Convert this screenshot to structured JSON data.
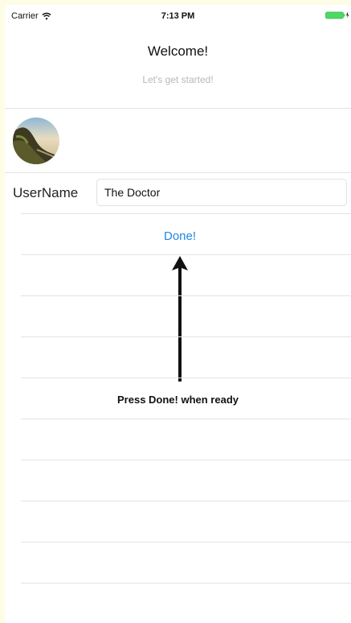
{
  "status_bar": {
    "carrier": "Carrier",
    "time": "7:13 PM",
    "icons": [
      "wifi-icon",
      "battery-icon"
    ],
    "battery_color": "#4cd964"
  },
  "header": {
    "title": "Welcome!",
    "subtitle": "Let's get started!"
  },
  "profile": {
    "avatar_icon": "avatar-photo"
  },
  "form": {
    "username_label": "UserName",
    "username_value": "The Doctor",
    "done_label": "Done!",
    "done_color": "#1e88e5"
  },
  "annotation": {
    "hint_text": "Press Done! when ready",
    "arrow_icon": "up-arrow-icon"
  }
}
